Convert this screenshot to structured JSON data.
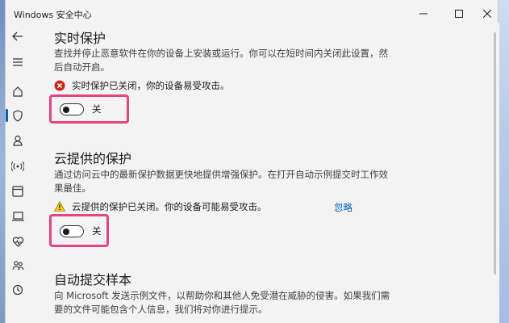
{
  "window": {
    "title": "Windows 安全中心"
  },
  "sections": {
    "realtime": {
      "title": "实时保护",
      "description": "查找并停止恶意软件在你的设备上安装或运行。你可以在短时间内关闭此设置，然后自动开启。",
      "status": "实时保护已关闭，你的设备易受攻击。",
      "toggle_label": "关",
      "toggle_state": "off"
    },
    "cloud": {
      "title": "云提供的保护",
      "description": "通过访问云中的最新保护数据更快地提供增强保护。在打开自动示例提交时工作效果最佳。",
      "status": "云提供的保护已关闭。你的设备可能易受攻击。",
      "dismiss": "忽略",
      "toggle_label": "关",
      "toggle_state": "off"
    },
    "sample": {
      "title": "自动提交样本",
      "description": "向 Microsoft 发送示例文件，以帮助你和其他人免受潜在威胁的侵害。如果我们需要的文件可能包含个人信息，我们将对你进行提示。"
    }
  },
  "colors": {
    "accent": "#005fb8",
    "highlight": "#e2457f",
    "error": "#c42b1c",
    "warning": "#f2c811"
  },
  "icons": {
    "sidebar": [
      "back-icon",
      "menu-icon",
      "home-icon",
      "shield-icon",
      "person-icon",
      "wireless-icon",
      "app-browser-icon",
      "device-icon",
      "heart-icon",
      "family-icon",
      "history-icon"
    ]
  }
}
